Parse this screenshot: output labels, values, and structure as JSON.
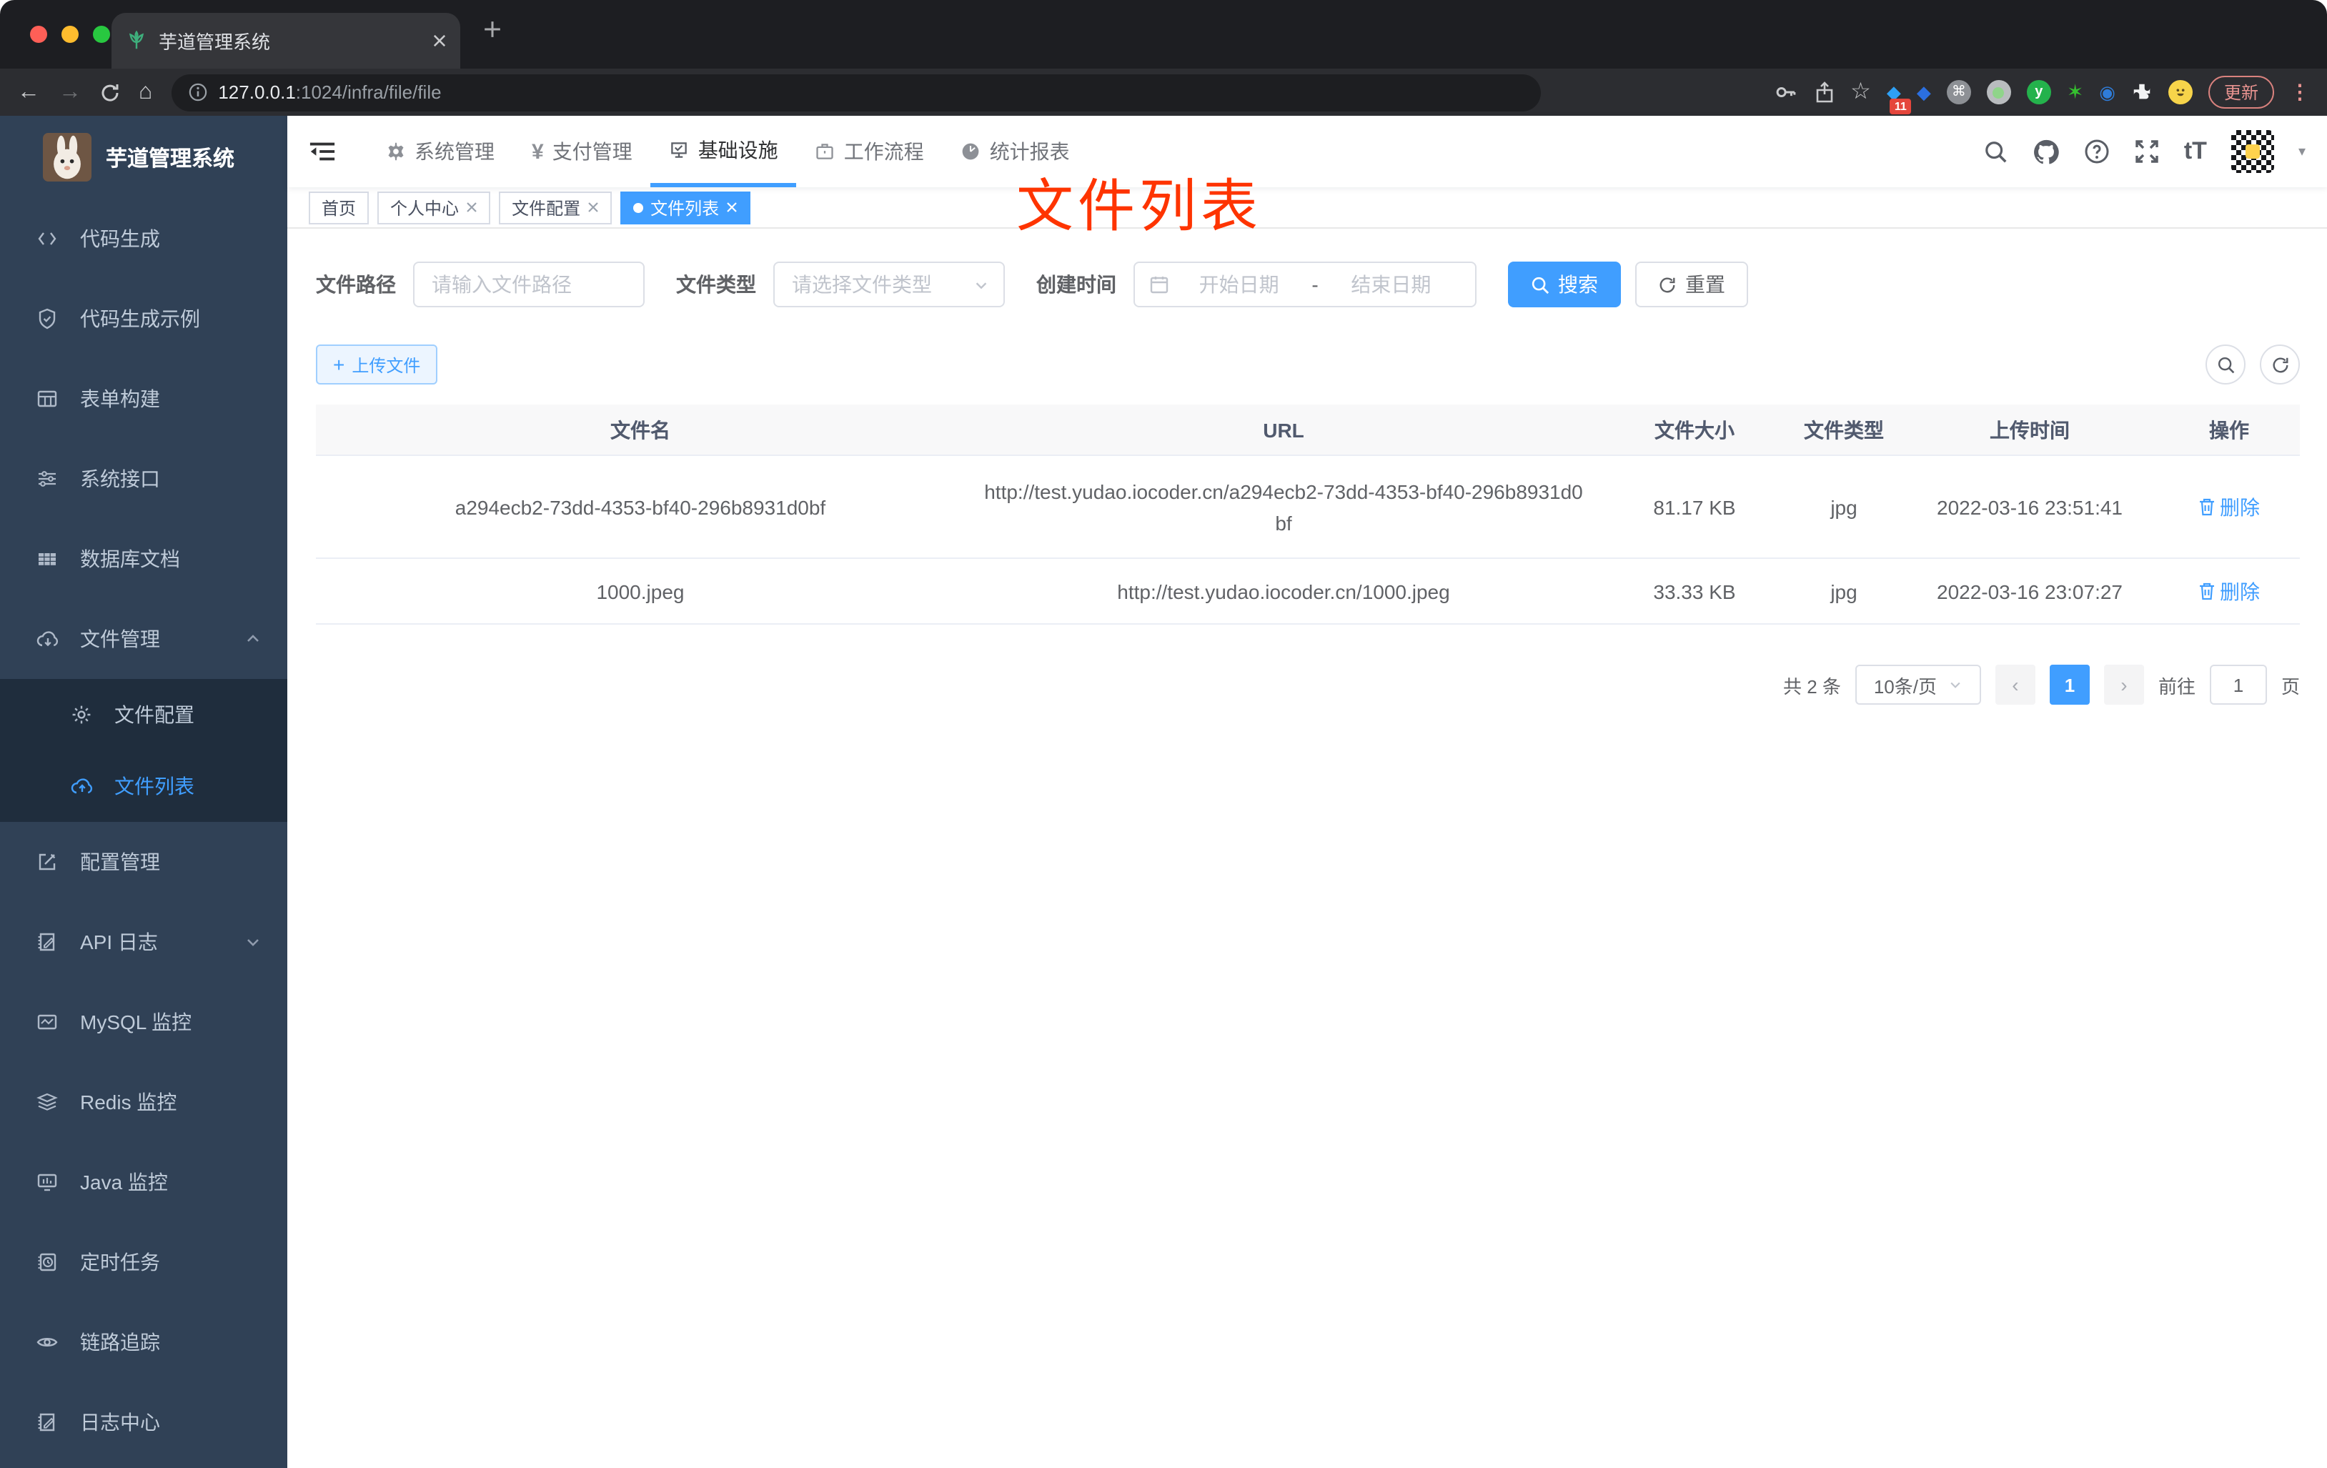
{
  "browser": {
    "tab_title": "芋道管理系统",
    "url_host": "127.0.0.1",
    "url_rest": ":1024/infra/file/file",
    "ext_badge": "11",
    "update_label": "更新"
  },
  "glyphs": {
    "back": "←",
    "forward": "→",
    "home": "⌂",
    "star": "☆",
    "ellipsis": "⋮",
    "cmd": "⌘",
    "y_logo": "y",
    "green_star": "✶",
    "eye_ext": "◉",
    "diamond": "◆",
    "question": "?",
    "text_size": "tT",
    "caret": "▾",
    "yen": "¥",
    "plus": "+",
    "prev": "‹",
    "next": "›"
  },
  "sidebar": {
    "title": "芋道管理系统",
    "items": [
      {
        "label": "代码生成"
      },
      {
        "label": "代码生成示例"
      },
      {
        "label": "表单构建"
      },
      {
        "label": "系统接口"
      },
      {
        "label": "数据库文档"
      },
      {
        "label": "文件管理"
      },
      {
        "label": "文件配置"
      },
      {
        "label": "文件列表"
      },
      {
        "label": "配置管理"
      },
      {
        "label": "API 日志"
      },
      {
        "label": "MySQL 监控"
      },
      {
        "label": "Redis 监控"
      },
      {
        "label": "Java 监控"
      },
      {
        "label": "定时任务"
      },
      {
        "label": "链路追踪"
      },
      {
        "label": "日志中心"
      }
    ]
  },
  "topnav": {
    "menus": [
      {
        "label": "系统管理"
      },
      {
        "label": "支付管理"
      },
      {
        "label": "基础设施"
      },
      {
        "label": "工作流程"
      },
      {
        "label": "统计报表"
      }
    ]
  },
  "tags": [
    {
      "label": "首页"
    },
    {
      "label": "个人中心"
    },
    {
      "label": "文件配置"
    },
    {
      "label": "文件列表"
    }
  ],
  "overlay_title": "文件列表",
  "filters": {
    "path_label": "文件路径",
    "path_placeholder": "请输入文件路径",
    "type_label": "文件类型",
    "type_placeholder": "请选择文件类型",
    "time_label": "创建时间",
    "start_placeholder": "开始日期",
    "separator": "-",
    "end_placeholder": "结束日期",
    "search_label": "搜索",
    "reset_label": "重置"
  },
  "toolbar": {
    "upload_label": "上传文件"
  },
  "table": {
    "headers": [
      "文件名",
      "URL",
      "文件大小",
      "文件类型",
      "上传时间",
      "操作"
    ],
    "rows": [
      {
        "name": "a294ecb2-73dd-4353-bf40-296b8931d0bf",
        "url": "http://test.yudao.iocoder.cn/a294ecb2-73dd-4353-bf40-296b8931d0bf",
        "size": "81.17 KB",
        "type": "jpg",
        "time": "2022-03-16 23:51:41",
        "action": "删除"
      },
      {
        "name": "1000.jpeg",
        "url": "http://test.yudao.iocoder.cn/1000.jpeg",
        "size": "33.33 KB",
        "type": "jpg",
        "time": "2022-03-16 23:07:27",
        "action": "删除"
      }
    ]
  },
  "pagination": {
    "total": "共 2 条",
    "page_size": "10条/页",
    "current_page": "1",
    "goto_label": "前往",
    "goto_value": "1",
    "page_unit": "页"
  },
  "colors": {
    "accent": "#409eff",
    "sidebar_bg": "#304156",
    "submenu_bg": "#1f2d3d",
    "red_title": "#fe3400"
  }
}
